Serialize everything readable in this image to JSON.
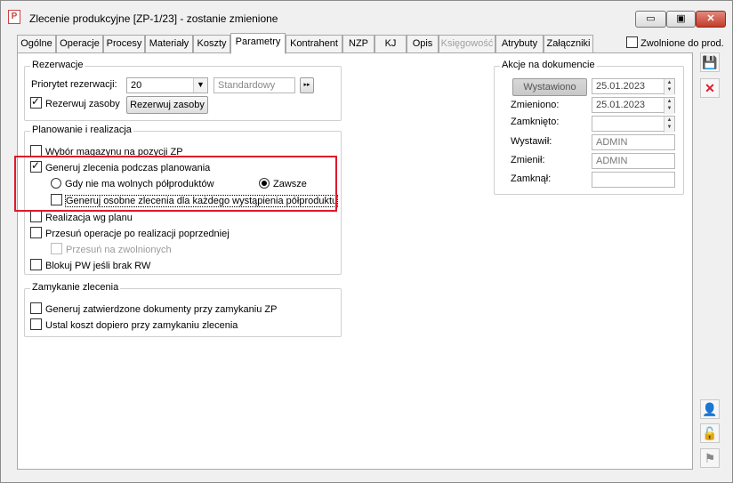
{
  "window": {
    "title": "Zlecenie produkcyjne [ZP-1/23] - zostanie zmienione",
    "app_icon_letter": "P",
    "min_glyph": "▭",
    "max_glyph": "▣",
    "close_glyph": "✕"
  },
  "tabs": [
    "Ogólne",
    "Operacje",
    "Procesy",
    "Materiały",
    "Koszty",
    "Parametry",
    "Kontrahent",
    "NZP",
    "KJ",
    "Opis",
    "Księgowość",
    "Atrybuty",
    "Załączniki"
  ],
  "active_tab": "Parametry",
  "zwolnione_label": "Zwolnione do prod.",
  "rezerwacje": {
    "title": "Rezerwacje",
    "priorytet_label": "Priorytet rezerwacji:",
    "priorytet_value": "20",
    "priorytet_name": "Standardowy",
    "rezerwuj_zasoby_checkbox": "Rezerwuj zasoby",
    "rezerwuj_zasoby_button": "Rezerwuj zasoby"
  },
  "planowanie": {
    "title": "Planowanie i realizacja",
    "wybor_magazynu": "Wybór magazynu na pozycji ZP",
    "generuj_zlecenia": "Generuj zlecenia podczas planowania",
    "radio_gdy": "Gdy nie ma wolnych półproduktów",
    "radio_zawsze": "Zawsze",
    "generuj_osobne": "Generuj osobne zlecenia dla każdego wystąpienia półproduktu",
    "realizacja_wg_planu": "Realizacja wg planu",
    "przesun_operacje": "Przesuń operacje po realizacji poprzedniej",
    "przesun_na_zwolnionych": "Przesuń na zwolnionych",
    "blokuj_pw": "Blokuj PW jeśli brak RW"
  },
  "zamykanie": {
    "title": "Zamykanie zlecenia",
    "generuj_zatwierdzone": "Generuj zatwierdzone dokumenty przy zamykaniu ZP",
    "ustal_koszt": "Ustal koszt dopiero przy zamykaniu zlecenia"
  },
  "akcje": {
    "title": "Akcje na dokumencie",
    "wystawiono_button": "Wystawiono",
    "wystawiono_date": "25.01.2023",
    "zmieniono_label": "Zmieniono:",
    "zmieniono_date": "25.01.2023",
    "zamknieto_label": "Zamknięto:",
    "zamknieto_date": "",
    "wystawil_label": "Wystawił:",
    "wystawil_value": "ADMIN",
    "zmienil_label": "Zmienił:",
    "zmienil_value": "ADMIN",
    "zamknal_label": "Zamknął:",
    "zamknal_value": ""
  },
  "side_icons": {
    "save": "💾",
    "cancel": "✕",
    "users": "👤",
    "lock": "🔓",
    "pin": "⚑"
  },
  "colors": {
    "highlight": "#e0192b",
    "cancel_icon": "#e0192b"
  }
}
